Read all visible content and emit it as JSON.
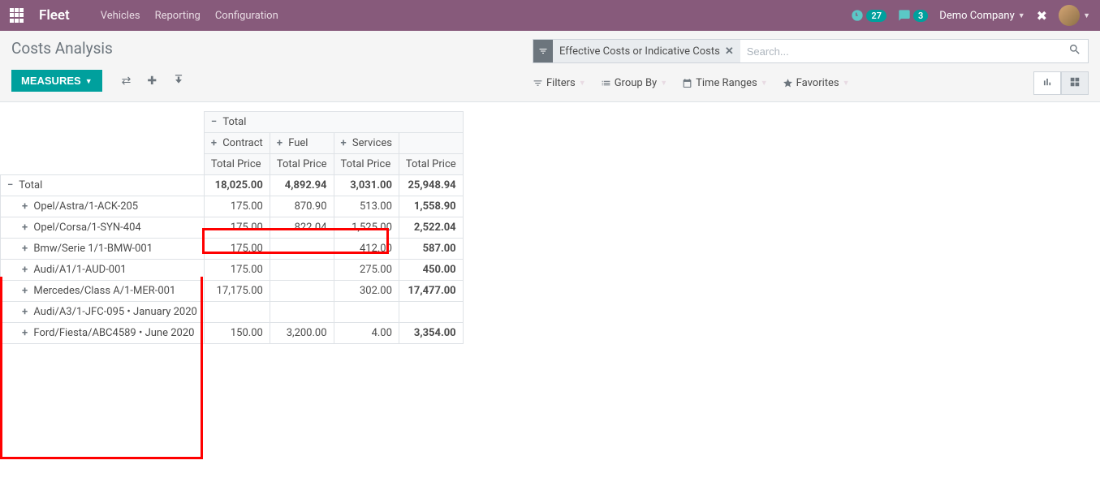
{
  "navbar": {
    "brand": "Fleet",
    "links": [
      "Vehicles",
      "Reporting",
      "Configuration"
    ],
    "activity_count": "27",
    "chat_count": "3",
    "company": "Demo Company"
  },
  "page": {
    "title": "Costs Analysis",
    "measures_btn": "MEASURES"
  },
  "search": {
    "filter_pill": "Effective Costs or Indicative Costs",
    "placeholder": "Search..."
  },
  "filters": {
    "filters": "Filters",
    "groupby": "Group By",
    "timeranges": "Time Ranges",
    "favorites": "Favorites"
  },
  "pivot": {
    "top_total": "Total",
    "col_headers": [
      "Contract",
      "Fuel",
      "Services"
    ],
    "measure_label": "Total Price",
    "rows": [
      {
        "label": "Total",
        "bold": true,
        "expand": "-",
        "indent": false,
        "vals": [
          "18,025.00",
          "4,892.94",
          "3,031.00",
          "25,948.94"
        ]
      },
      {
        "label": "Opel/Astra/1-ACK-205",
        "expand": "+",
        "indent": true,
        "vals": [
          "175.00",
          "870.90",
          "513.00",
          "1,558.90"
        ]
      },
      {
        "label": "Opel/Corsa/1-SYN-404",
        "expand": "+",
        "indent": true,
        "vals": [
          "175.00",
          "822.04",
          "1,525.00",
          "2,522.04"
        ]
      },
      {
        "label": "Bmw/Serie 1/1-BMW-001",
        "expand": "+",
        "indent": true,
        "vals": [
          "175.00",
          "",
          "412.00",
          "587.00"
        ]
      },
      {
        "label": "Audi/A1/1-AUD-001",
        "expand": "+",
        "indent": true,
        "vals": [
          "175.00",
          "",
          "275.00",
          "450.00"
        ]
      },
      {
        "label": "Mercedes/Class A/1-MER-001",
        "expand": "+",
        "indent": true,
        "vals": [
          "17,175.00",
          "",
          "302.00",
          "17,477.00"
        ]
      },
      {
        "label": "Audi/A3/1-JFC-095 • January 2020",
        "expand": "+",
        "indent": true,
        "vals": [
          "",
          "",
          "",
          ""
        ]
      },
      {
        "label": "Ford/Fiesta/ABC4589 • June 2020",
        "expand": "+",
        "indent": true,
        "vals": [
          "150.00",
          "3,200.00",
          "4.00",
          "3,354.00"
        ]
      }
    ]
  }
}
